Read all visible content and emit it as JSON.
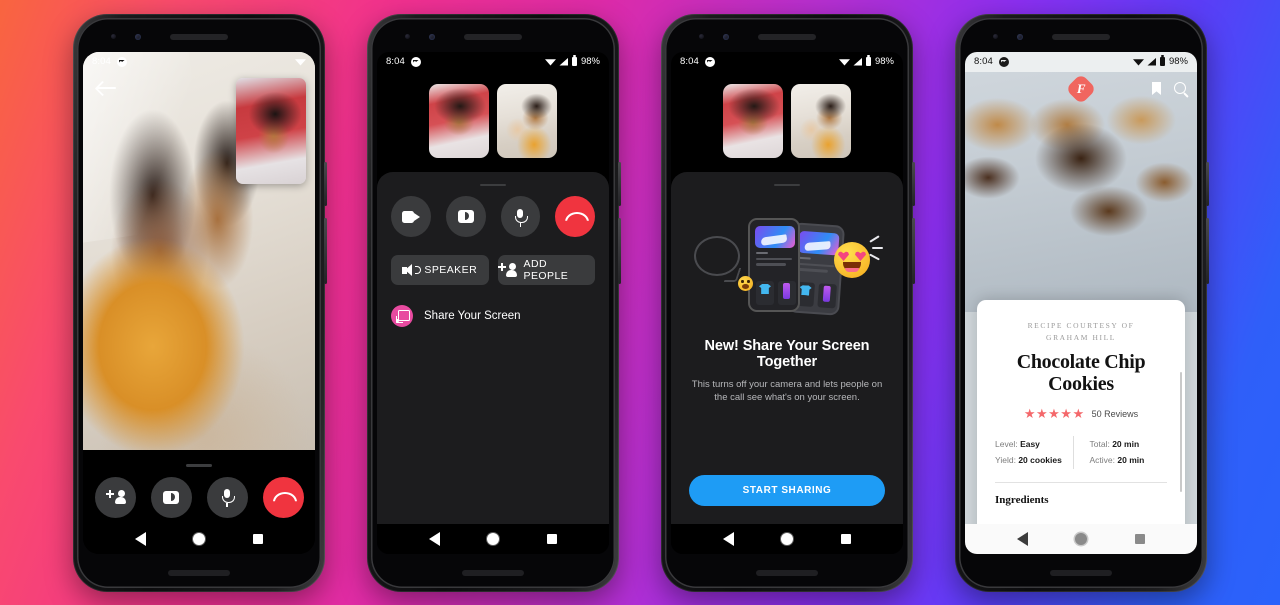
{
  "background": {
    "gradient_start": "#f9653f",
    "gradient_mid": "#b52fd0",
    "gradient_end": "#2a62fb"
  },
  "status_bar": {
    "time": "8:04",
    "app_icon": "messenger-icon",
    "wifi": "wifi-icon",
    "signal": "signal-icon",
    "battery": "battery-icon",
    "battery_pct": "98%"
  },
  "nav_bar": {
    "back": "back-triangle-icon",
    "home": "home-circle-icon",
    "recents": "recents-square-icon"
  },
  "phone1": {
    "name": "video-call-fullscreen",
    "back_icon": "back-arrow-icon",
    "pip_label": "self-view-thumbnail",
    "controls": [
      {
        "name": "add-person-button",
        "icon": "add-person-icon",
        "style": "grey"
      },
      {
        "name": "flip-camera-button",
        "icon": "flip-camera-icon",
        "style": "grey"
      },
      {
        "name": "mute-button",
        "icon": "microphone-icon",
        "style": "grey"
      },
      {
        "name": "end-call-button",
        "icon": "end-call-icon",
        "style": "red"
      }
    ]
  },
  "phone2": {
    "name": "call-controls-sheet",
    "thumbnails": [
      "participant-1-video",
      "participant-2-video"
    ],
    "controls": [
      {
        "name": "video-button",
        "icon": "video-camera-icon",
        "style": "grey"
      },
      {
        "name": "flip-camera-button",
        "icon": "flip-camera-icon",
        "style": "grey"
      },
      {
        "name": "mute-button",
        "icon": "microphone-icon",
        "style": "grey"
      },
      {
        "name": "end-call-button",
        "icon": "end-call-icon",
        "style": "red"
      }
    ],
    "speaker_label": "SPEAKER",
    "add_people_label": "ADD PEOPLE",
    "share_screen_label": "Share Your Screen",
    "share_icon_color": "#e84aa0"
  },
  "phone3": {
    "name": "share-screen-promo",
    "thumbnails": [
      "participant-1-video",
      "participant-2-video"
    ],
    "title": "New! Share Your Screen Together",
    "subtitle": "This turns off your camera and lets people on the call see what's on your screen.",
    "cta_label": "START SHARING",
    "cta_color": "#1e9cf5"
  },
  "phone4": {
    "name": "recipe-article",
    "logo_letter": "F",
    "logo_color": "#f0665f",
    "bookmark_icon": "bookmark-icon",
    "search_icon": "search-icon",
    "courtesy_line1": "RECIPE COURTESY OF",
    "courtesy_line2": "GRAHAM HILL",
    "title_line1": "Chocolate Chip",
    "title_line2": "Cookies",
    "stars": "★★★★★",
    "star_color": "#f4686b",
    "reviews": "50 Reviews",
    "meta": [
      {
        "label": "Level:",
        "value": "Easy"
      },
      {
        "label": "Yield:",
        "value": "20 cookies"
      },
      {
        "label": "Total:",
        "value": "20 min"
      },
      {
        "label": "Active:",
        "value": "20 min"
      }
    ],
    "ingredients_heading": "Ingredients"
  }
}
